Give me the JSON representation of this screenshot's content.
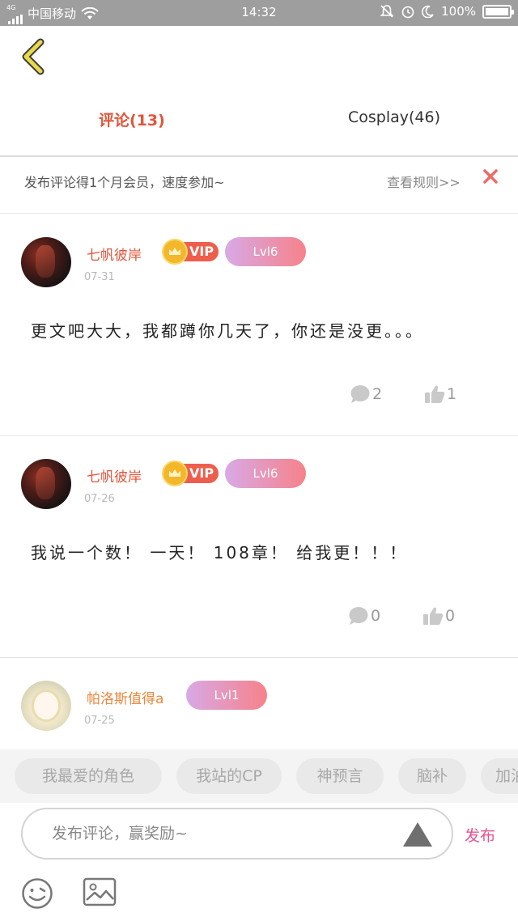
{
  "status_bar": {
    "network": "4G",
    "carrier": "中国移动",
    "time": "14:32",
    "battery": "100%"
  },
  "header": {
    "back_icon": "chevron-left-icon",
    "tabs": [
      {
        "label": "评论(13)",
        "active": true
      },
      {
        "label": "Cosplay(46)",
        "active": false
      }
    ]
  },
  "notice": {
    "text": "发布评论得1个月会员，速度参加~",
    "rules_link": "查看规则>>",
    "close_icon": "close-icon"
  },
  "comments": [
    {
      "username": "七帆彼岸",
      "vip": "VIP",
      "level": "Lvl6",
      "date": "07-31",
      "text": "更文吧大大，我都蹲你几天了，你还是没更。。。",
      "replies": "2",
      "likes": "1"
    },
    {
      "username": "七帆彼岸",
      "vip": "VIP",
      "level": "Lvl6",
      "date": "07-26",
      "text": "我说一个数！ 一天！ 108章！ 给我更！！！",
      "replies": "0",
      "likes": "0"
    },
    {
      "username": "帕洛斯值得a",
      "level": "Lvl1",
      "date": "07-25"
    }
  ],
  "chips": [
    "我最爱的角色",
    "我站的CP",
    "神预言",
    "脑补",
    "加油"
  ],
  "input_bar": {
    "placeholder": "发布评论，赢奖励~",
    "send_label": "发布"
  },
  "colors": {
    "accent_red": "#e2553a",
    "send_pink": "#e8548e",
    "level_gradient_start": "#d8a9e6",
    "level_gradient_end": "#f6828a",
    "back_icon_yellow": "#e9d84a"
  }
}
